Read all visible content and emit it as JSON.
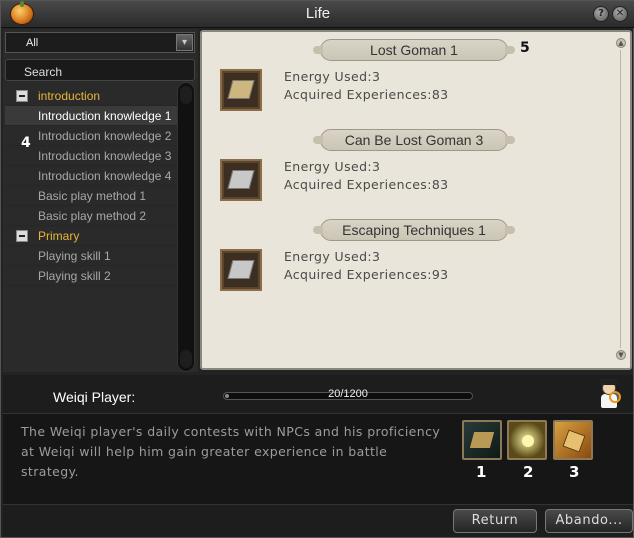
{
  "window": {
    "title": "Life"
  },
  "sidebar": {
    "filter_value": "All",
    "search_label": "Search",
    "categories": [
      {
        "label": "introduction",
        "items": [
          "Introduction knowledge 1",
          "Introduction knowledge 2",
          "Introduction knowledge 3",
          "Introduction knowledge 4",
          "Basic play method 1",
          "Basic play method 2"
        ]
      },
      {
        "label": "Primary",
        "items": [
          "Playing skill 1",
          "Playing skill 2"
        ]
      }
    ],
    "selected_item": "Introduction knowledge 1"
  },
  "entries": [
    {
      "title": "Lost Goman 1",
      "energy": "Energy Used:3",
      "exp": "Acquired Experiences:83"
    },
    {
      "title": "Can Be Lost Goman 3",
      "energy": "Energy Used:3",
      "exp": "Acquired Experiences:83"
    },
    {
      "title": "Escaping Techniques 1",
      "energy": "Energy Used:3",
      "exp": "Acquired Experiences:93"
    }
  ],
  "profession": {
    "label": "Weiqi Player:",
    "progress_text": "20/1200",
    "progress_fraction": 0.0167,
    "description": "The Weiqi player's daily contests with NPCs and his proficiency at Weiqi will help him gain greater experience in battle strategy."
  },
  "annotations": {
    "m1": "1",
    "m2": "2",
    "m3": "3",
    "m4": "4",
    "m5": "5"
  },
  "buttons": {
    "return": "Return",
    "abandon": "Abando..."
  },
  "icons": [
    "pumpkin-app-icon",
    "help-icon",
    "close-icon",
    "chevron-down-icon",
    "minus-icon",
    "npc-magnifier-icon",
    "skill-board-icon",
    "skill-light-icon",
    "skill-scroll-icon"
  ]
}
